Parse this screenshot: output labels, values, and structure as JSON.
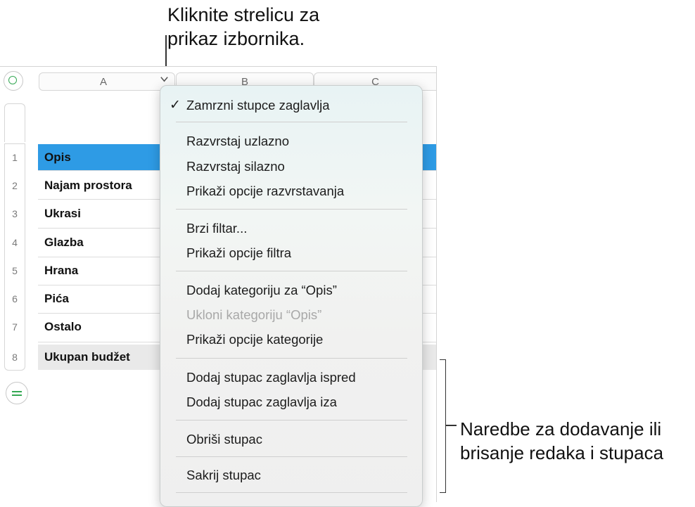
{
  "callouts": {
    "top_line1": "Kliknite strelicu za",
    "top_line2": "prikaz izbornika.",
    "right_line1": "Naredbe za dodavanje ili",
    "right_line2": "brisanje redaka i stupaca"
  },
  "table": {
    "columns": [
      "A",
      "B",
      "C"
    ],
    "rows": [
      {
        "num": "1",
        "label": "Opis"
      },
      {
        "num": "2",
        "label": "Najam prostora"
      },
      {
        "num": "3",
        "label": "Ukrasi"
      },
      {
        "num": "4",
        "label": "Glazba"
      },
      {
        "num": "5",
        "label": "Hrana"
      },
      {
        "num": "6",
        "label": "Pića"
      },
      {
        "num": "7",
        "label": "Ostalo"
      },
      {
        "num": "8",
        "label": "Ukupan budžet"
      }
    ],
    "header_row_color": "#2e9be5",
    "footer_row_color": "#e9e9e9"
  },
  "menu": {
    "check_glyph": "✓",
    "items": [
      {
        "label": "Zamrzni stupce zaglavlja",
        "checked": true
      },
      {
        "label": "Razvrstaj uzlazno"
      },
      {
        "label": "Razvrstaj silazno"
      },
      {
        "label": "Prikaži opcije razvrstavanja"
      },
      {
        "label": "Brzi filtar..."
      },
      {
        "label": "Prikaži opcije filtra"
      },
      {
        "label": "Dodaj kategoriju za “Opis”"
      },
      {
        "label": "Ukloni kategoriju “Opis”",
        "disabled": true
      },
      {
        "label": "Prikaži opcije kategorije"
      },
      {
        "label": "Dodaj stupac zaglavlja ispred"
      },
      {
        "label": "Dodaj stupac zaglavlja iza"
      },
      {
        "label": "Obriši stupac"
      },
      {
        "label": "Sakrij stupac"
      }
    ]
  },
  "icons": {
    "corner": "circle-icon",
    "add_row": "add-rows-icon",
    "chevron": "chevron-down-icon"
  }
}
